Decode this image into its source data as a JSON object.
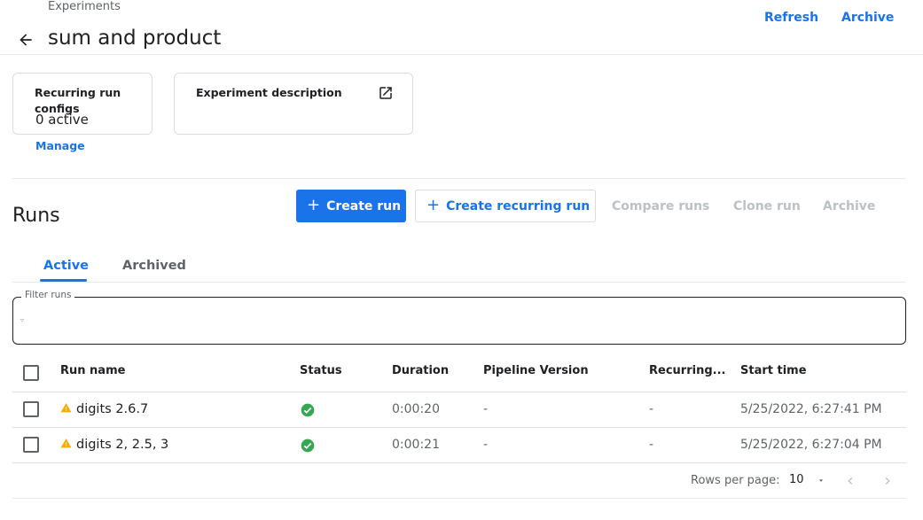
{
  "header": {
    "breadcrumb": "Experiments",
    "title": "sum and product",
    "refresh_label": "Refresh",
    "archive_label": "Archive"
  },
  "recurring_card": {
    "title": "Recurring run configs",
    "value": "0 active",
    "manage_label": "Manage"
  },
  "description_card": {
    "title": "Experiment description"
  },
  "runs": {
    "title": "Runs",
    "toolbar": {
      "create_run": "Create run",
      "create_recurring_run": "Create recurring run",
      "compare_runs": "Compare runs",
      "clone_run": "Clone run",
      "archive": "Archive"
    },
    "tabs": [
      {
        "label": "Active",
        "selected": true
      },
      {
        "label": "Archived",
        "selected": false
      }
    ],
    "filter": {
      "label": "Filter runs",
      "value": ""
    },
    "columns": [
      "Run name",
      "Status",
      "Duration",
      "Pipeline Version",
      "Recurring...",
      "Start time"
    ],
    "rows": [
      {
        "name": "digits 2.6.7",
        "status": "succeeded",
        "duration": "0:00:20",
        "pipeline_version": "-",
        "recurring": "-",
        "start_time": "5/25/2022, 6:27:41 PM"
      },
      {
        "name": "digits 2, 2.5, 3",
        "status": "succeeded",
        "duration": "0:00:21",
        "pipeline_version": "-",
        "recurring": "-",
        "start_time": "5/25/2022, 6:27:04 PM"
      }
    ],
    "pagination": {
      "rows_per_page_label": "Rows per page:",
      "rows_per_page_value": "10"
    }
  },
  "colors": {
    "accent": "#1a73e8",
    "success": "#34a853",
    "warning": "#f9ab00",
    "disabled": "#bdc1c6"
  },
  "icons": {
    "back": "arrow-back-icon",
    "external": "open-in-new-icon",
    "plus": "plus-icon",
    "filter": "filter-icon",
    "warning": "warning-icon",
    "success": "check-circle-icon",
    "dropdown": "caret-down-icon",
    "prev": "chevron-left-icon",
    "next": "chevron-right-icon"
  }
}
